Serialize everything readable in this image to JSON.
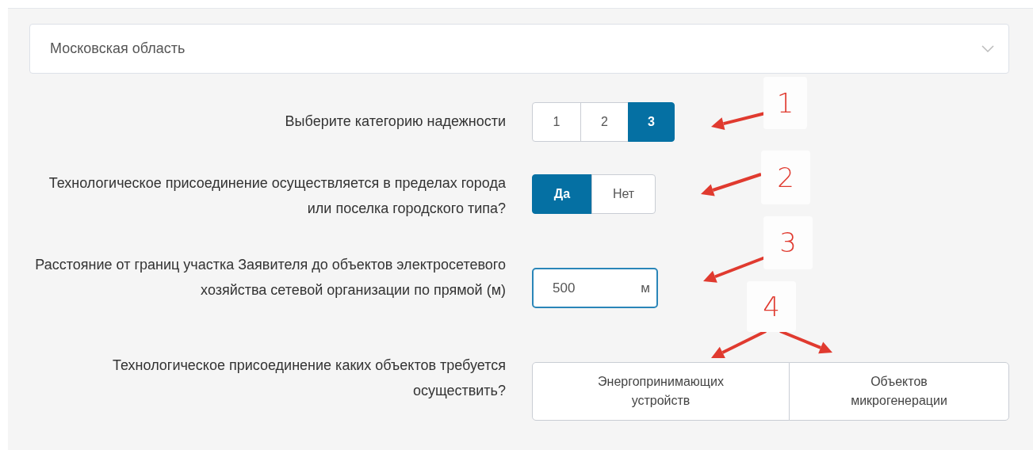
{
  "region_select": {
    "value": "Московская область"
  },
  "fields": [
    {
      "kind": "segmented",
      "label": "Выберите категорию надежности",
      "options": [
        {
          "label": "1",
          "selected": false
        },
        {
          "label": "2",
          "selected": false
        },
        {
          "label": "3",
          "selected": true
        }
      ]
    },
    {
      "kind": "segmented",
      "label": "Технологическое присоединение осуществляется в пределах города или поселка городского типа?",
      "options": [
        {
          "label": "Да",
          "selected": true
        },
        {
          "label": "Нет",
          "selected": false
        }
      ]
    },
    {
      "kind": "input",
      "label": "Расстояние от границ участка Заявителя до объектов электросетевого хозяйства сетевой организации по прямой (м)",
      "value": "500",
      "unit": "м"
    },
    {
      "kind": "choice",
      "label": "Технологическое присоединение каких объектов требуется осуществить?",
      "options": [
        {
          "label": "Энергопринимающих устройств"
        },
        {
          "label": "Объектов микрогенерации"
        }
      ]
    }
  ],
  "annotations": [
    {
      "label": "1"
    },
    {
      "label": "2"
    },
    {
      "label": "3"
    },
    {
      "label": "4"
    }
  ]
}
